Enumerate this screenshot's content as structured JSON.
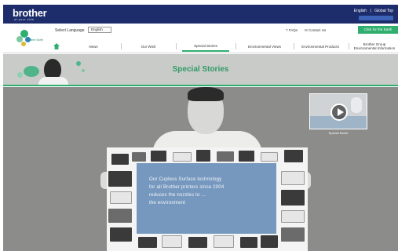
{
  "topbar": {
    "logo": "brother",
    "tagline": "at your side",
    "lang_current": "English",
    "lang_separator": "|",
    "lang_other": "Global Top"
  },
  "header": {
    "site_logo_text": "Brother Earth",
    "select_language_label": "Select Language",
    "language_value": "English",
    "faq_label": "FAQs",
    "contact_label": "Contact Us",
    "cta_label": "Click for the Earth"
  },
  "nav": {
    "items": [
      {
        "label": "News"
      },
      {
        "label": "Our Wish"
      },
      {
        "label": "Special Stories"
      },
      {
        "label": "Environmental Views"
      },
      {
        "label": "Environmental Products"
      },
      {
        "label": "Brother Group Environmental Information"
      }
    ],
    "active_index": 2
  },
  "banner": {
    "title": "Special Stories"
  },
  "stage": {
    "video_label": "Special Movie",
    "poster_lines": [
      "Our Cupless Surface technology",
      "for all Brother printers since 2004",
      "reduces the nozzles to ...",
      "the environment"
    ]
  },
  "colors": {
    "topbar": "#1d2d6b",
    "accent_green": "#2fae6e",
    "banner_grey": "#c9cbc9",
    "stage_grey": "#8c8c8b",
    "overlay_blue": "#5c84b2"
  }
}
